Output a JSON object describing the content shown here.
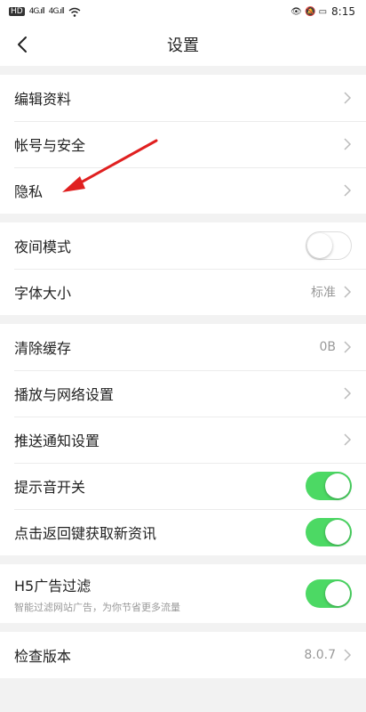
{
  "status": {
    "left_icons": "HD",
    "signal1": "4G.ıll",
    "signal2": "4G.ıll",
    "right_icons": "👁 🔕 ▭",
    "time": "8:15"
  },
  "nav": {
    "title": "设置"
  },
  "group1": [
    "编辑资料",
    "帐号与安全",
    "隐私"
  ],
  "group2": {
    "night_mode": "夜间模式",
    "font_size": "字体大小",
    "font_size_value": "标准"
  },
  "group3": {
    "clear_cache": "清除缓存",
    "cache_value": "0B",
    "playback": "播放与网络设置",
    "push": "推送通知设置",
    "sound": "提示音开关",
    "back_refresh": "点击返回键获取新资讯"
  },
  "group4": {
    "ad_filter": "H5广告过滤",
    "ad_filter_sub": "智能过滤网站广告，为你节省更多流量"
  },
  "group5": {
    "check_version": "检查版本",
    "version": "8.0.7"
  },
  "colors": {
    "toggle_on": "#4cd964",
    "annotation_arrow": "#e02020"
  },
  "toggles": {
    "night_mode": false,
    "sound": true,
    "back_refresh": true,
    "ad_filter": true
  }
}
